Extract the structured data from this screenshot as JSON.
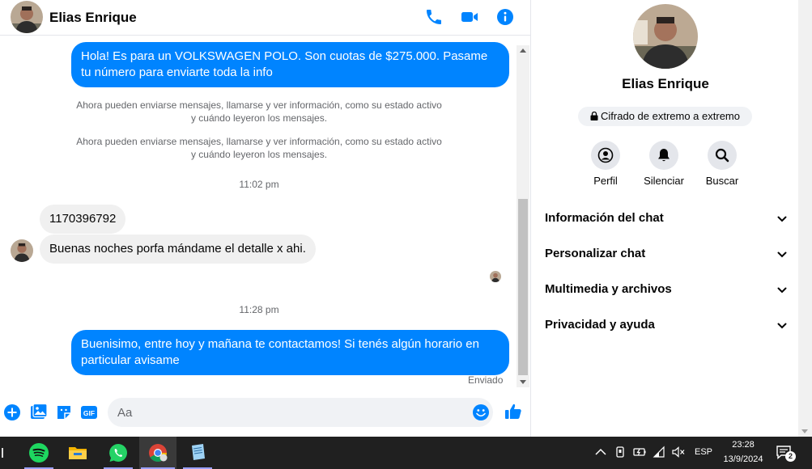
{
  "contact": {
    "name": "Elias Enrique"
  },
  "colors": {
    "accent": "#0084ff",
    "bubble_in": "#f0f0f0",
    "meta_text": "#65676b"
  },
  "header_icons": [
    "phone-icon",
    "video-camera-icon",
    "info-icon"
  ],
  "messages": {
    "out_1": "Hola! Es para un VOLKSWAGEN POLO. Son cuotas de $275.000. Pasame tu número para enviarte toda la info",
    "system_1": "Ahora pueden enviarse mensajes, llamarse y ver información, como su estado activo y cuándo leyeron los mensajes.",
    "system_2": "Ahora pueden enviarse mensajes, llamarse y ver información, como su estado activo y cuándo leyeron los mensajes.",
    "time_1": "11:02 pm",
    "in_1": "1170396792",
    "in_2": "Buenas noches porfa mándame el detalle x ahi.",
    "time_2": "11:28 pm",
    "out_2": "Buenisimo, entre hoy y mañana te contactamos! Si tenés algún horario en particular avisame",
    "status": "Enviado"
  },
  "composer": {
    "placeholder": "Aa",
    "icons": [
      "plus-icon",
      "image-icon",
      "sticker-icon",
      "gif-icon",
      "emoji-icon",
      "thumbs-up-icon"
    ],
    "gif_label": "GIF"
  },
  "info_panel": {
    "name": "Elias Enrique",
    "encryption": "Cifrado de extremo a extremo",
    "actions": [
      {
        "label": "Perfil",
        "icon": "profile-icon"
      },
      {
        "label": "Silenciar",
        "icon": "bell-icon"
      },
      {
        "label": "Buscar",
        "icon": "search-icon"
      }
    ],
    "sections": [
      {
        "label": "Información del chat"
      },
      {
        "label": "Personalizar chat"
      },
      {
        "label": "Multimedia y archivos"
      },
      {
        "label": "Privacidad y ayuda"
      }
    ]
  },
  "taskbar": {
    "apps": [
      "spotify-icon",
      "file-explorer-icon",
      "whatsapp-icon",
      "chrome-icon",
      "notepad-icon"
    ],
    "language": "ESP",
    "time": "23:28",
    "date": "13/9/2024",
    "notifications": "2"
  }
}
